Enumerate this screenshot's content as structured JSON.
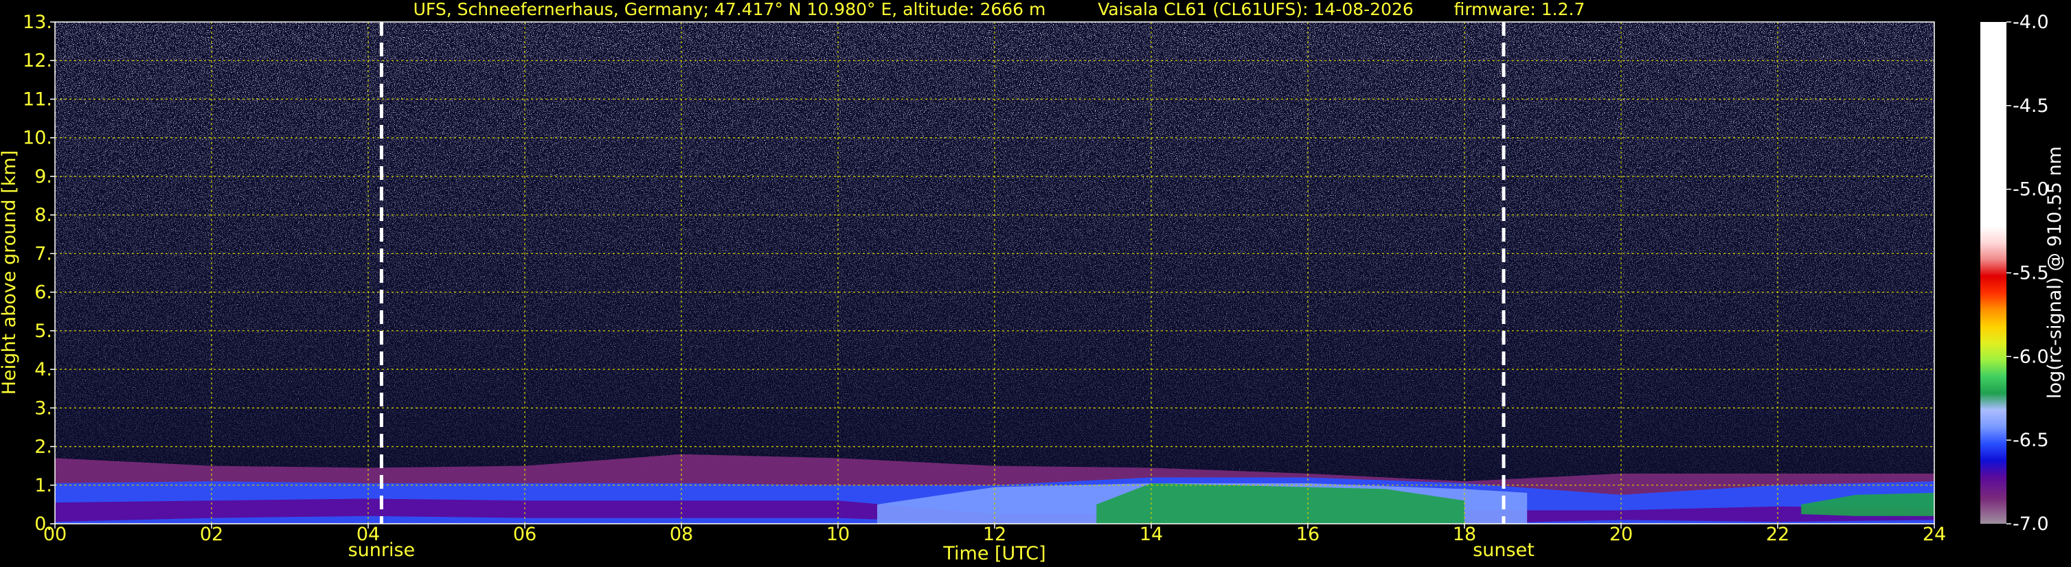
{
  "header": {
    "location": "UFS, Schneefernerhaus, Germany; 47.417° N 10.980° E, altitude: 2666 m",
    "instrument": "Vaisala CL61 (CL61UFS): 14-08-2026",
    "firmware": "firmware: 1.2.7"
  },
  "colors": {
    "text": "#ffff33",
    "grid": "#cccc00",
    "marker": "#ffffff",
    "background": "#000000"
  },
  "chart_data": {
    "type": "heatmap",
    "xlabel": "Time [UTC]",
    "ylabel": "Height above ground [km]",
    "xlim": [
      0,
      24
    ],
    "ylim": [
      0,
      13
    ],
    "x_ticks": [
      0,
      2,
      4,
      6,
      8,
      10,
      12,
      14,
      16,
      18,
      20,
      22,
      24
    ],
    "x_tick_labels": [
      "00",
      "02",
      "04",
      "06",
      "08",
      "10",
      "12",
      "14",
      "16",
      "18",
      "20",
      "22",
      "24"
    ],
    "y_ticks": [
      0,
      1,
      2,
      3,
      4,
      5,
      6,
      7,
      8,
      9,
      10,
      11,
      12,
      13
    ],
    "y_tick_labels": [
      "0.",
      "1.",
      "2.",
      "3.",
      "4.",
      "5.",
      "6.",
      "7.",
      "8.",
      "9.",
      "10.",
      "11.",
      "12.",
      "13."
    ],
    "grid": true,
    "markers": [
      {
        "label": "sunrise",
        "x": 4.17
      },
      {
        "label": "sunset",
        "x": 18.5
      }
    ],
    "colorbar": {
      "label": "log(rc-signal) @ 910.55 nm",
      "range": [
        -7.0,
        -4.0
      ],
      "ticks": [
        -7.0,
        -6.5,
        -6.0,
        -5.5,
        -5.0,
        -4.5,
        -4.0
      ],
      "tick_labels": [
        "-7.0",
        "-6.5",
        "-6.0",
        "-5.5",
        "-5.0",
        "-4.5",
        "-4.0"
      ],
      "stops": [
        {
          "v": -7.0,
          "c": "#a090a0"
        },
        {
          "v": -6.85,
          "c": "#7a2a7a"
        },
        {
          "v": -6.72,
          "c": "#5a0a9a"
        },
        {
          "v": -6.62,
          "c": "#1010d8"
        },
        {
          "v": -6.52,
          "c": "#2a50ff"
        },
        {
          "v": -6.42,
          "c": "#7a9aff"
        },
        {
          "v": -6.32,
          "c": "#aabcff"
        },
        {
          "v": -6.22,
          "c": "#20a050"
        },
        {
          "v": -6.12,
          "c": "#40d060"
        },
        {
          "v": -6.02,
          "c": "#a0f040"
        },
        {
          "v": -5.92,
          "c": "#e0f020"
        },
        {
          "v": -5.82,
          "c": "#ffd000"
        },
        {
          "v": -5.72,
          "c": "#ff9000"
        },
        {
          "v": -5.62,
          "c": "#ff3000"
        },
        {
          "v": -5.52,
          "c": "#e00000"
        },
        {
          "v": -5.42,
          "c": "#f08a8a"
        },
        {
          "v": -5.32,
          "c": "#ffd8d8"
        },
        {
          "v": -5.22,
          "c": "#ffffff"
        },
        {
          "v": -4.0,
          "c": "#ffffff"
        }
      ]
    },
    "layers": [
      {
        "x": [
          0,
          2,
          4,
          6,
          8,
          10,
          12,
          14,
          16,
          18,
          20,
          22,
          24
        ],
        "bottom": [
          0,
          0,
          0,
          0,
          0,
          0,
          0,
          0,
          0,
          0,
          0,
          0,
          0
        ],
        "top": [
          1.7,
          1.5,
          1.45,
          1.5,
          1.8,
          1.7,
          1.5,
          1.45,
          1.3,
          1.1,
          1.3,
          1.3,
          1.3
        ],
        "v": -6.85
      },
      {
        "x": [
          0,
          2,
          4,
          6,
          8,
          10,
          12,
          14,
          16,
          18,
          20,
          22,
          24
        ],
        "bottom": [
          0,
          0,
          0,
          0,
          0,
          0,
          0,
          0,
          0,
          0,
          0,
          0,
          0
        ],
        "top": [
          1.05,
          1.1,
          1.05,
          1.05,
          1.05,
          1.0,
          1.0,
          1.2,
          1.2,
          1.05,
          0.75,
          1.0,
          1.1
        ],
        "v": -6.55
      },
      {
        "x": [
          0,
          2,
          4,
          6,
          8,
          10,
          12,
          14,
          16,
          18,
          20,
          22,
          24
        ],
        "bottom": [
          0.05,
          0.15,
          0.2,
          0.15,
          0.15,
          0.15,
          0,
          0,
          0,
          0,
          0.1,
          0.05,
          0.1
        ],
        "top": [
          0.55,
          0.6,
          0.65,
          0.6,
          0.6,
          0.6,
          0.25,
          0.25,
          0.3,
          0.35,
          0.35,
          0.45,
          0.4
        ],
        "v": -6.78
      },
      {
        "x": [
          10.5,
          12,
          14,
          16,
          18,
          18.8
        ],
        "bottom": [
          0,
          0,
          0,
          0,
          0,
          0
        ],
        "top": [
          0.5,
          0.95,
          1.05,
          1.05,
          0.9,
          0.8
        ],
        "v": -6.38
      },
      {
        "x": [
          13.3,
          14,
          15,
          16,
          17,
          18
        ],
        "bottom": [
          0,
          0,
          0,
          0,
          0,
          0
        ],
        "top": [
          0.5,
          1.05,
          1.0,
          0.95,
          0.9,
          0.6
        ],
        "v": -6.2
      },
      {
        "x": [
          22.3,
          23,
          24
        ],
        "bottom": [
          0.25,
          0.2,
          0.2
        ],
        "top": [
          0.5,
          0.75,
          0.8
        ],
        "v": -6.2
      }
    ]
  }
}
